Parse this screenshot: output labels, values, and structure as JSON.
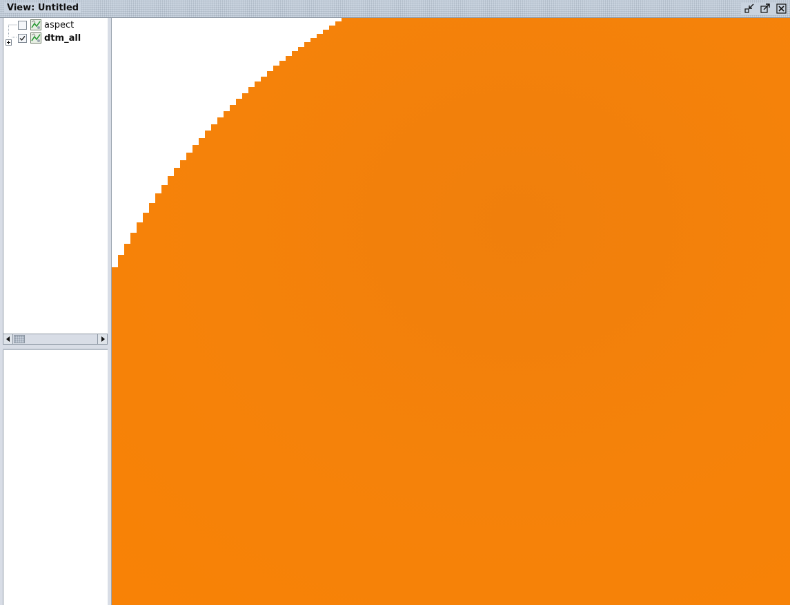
{
  "window": {
    "title": "View: Untitled"
  },
  "toc": {
    "layers": [
      {
        "name": "aspect",
        "checked": false,
        "icon": "raster-layer-icon"
      },
      {
        "name": "dtm_all",
        "checked": true,
        "icon": "raster-layer-icon",
        "expandable": true
      }
    ]
  },
  "map": {
    "colors": {
      "raster_fill": "#f5820a",
      "background": "#ffffff"
    }
  }
}
